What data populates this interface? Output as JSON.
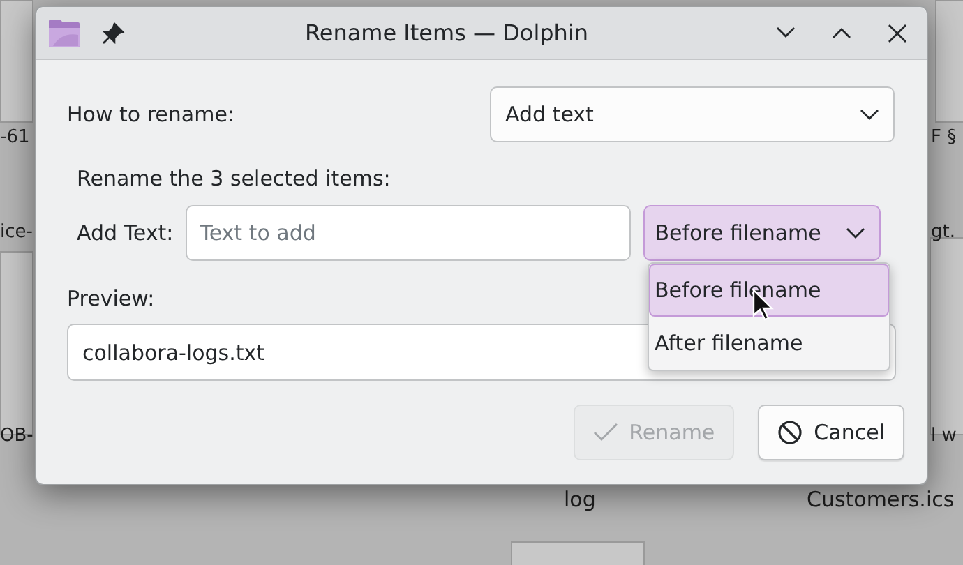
{
  "background_files": [
    {
      "label": "-61"
    },
    {
      "label": "ice-"
    },
    {
      "label": "F §"
    },
    {
      "label": "gt."
    },
    {
      "label": "OB-"
    },
    {
      "label": "l w"
    },
    {
      "label": "log"
    },
    {
      "label": "Customers.ics"
    }
  ],
  "window": {
    "title": "Rename Items — Dolphin"
  },
  "how_to_rename": {
    "label": "How to rename:",
    "value": "Add text"
  },
  "section_label": "Rename the 3 selected items:",
  "add_text": {
    "label": "Add Text:",
    "placeholder": "Text to add",
    "position": "Before filename",
    "expanded": true
  },
  "position_options": [
    {
      "label": "Before filename",
      "selected": true
    },
    {
      "label": "After filename",
      "selected": false
    }
  ],
  "preview": {
    "label": "Preview:",
    "value": "collabora-logs.txt"
  },
  "buttons": [
    {
      "label": "Rename",
      "kind": "confirm",
      "disabled": true
    },
    {
      "label": "Cancel",
      "kind": "cancel",
      "disabled": false
    }
  ]
}
